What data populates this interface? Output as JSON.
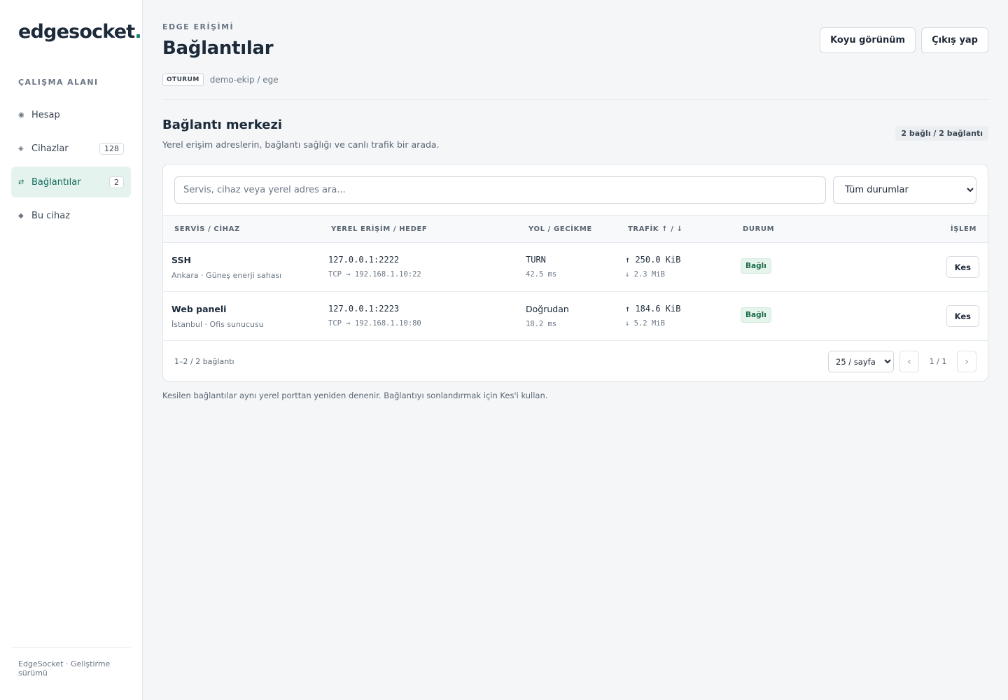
{
  "sidebar": {
    "logo_text": "edgesocket",
    "logo_dot": ".",
    "section_label": "ÇALIŞMA ALANI",
    "items": [
      {
        "icon": "◉",
        "icon_name": "account-icon",
        "label": "Hesap",
        "badge": ""
      },
      {
        "icon": "◈",
        "icon_name": "devices-icon",
        "label": "Cihazlar",
        "badge": "128"
      },
      {
        "icon": "⇄",
        "icon_name": "connections-icon",
        "label": "Bağlantılar",
        "badge": "2"
      },
      {
        "icon": "◆",
        "icon_name": "this-device-icon",
        "label": "Bu cihaz",
        "badge": ""
      }
    ],
    "footer": "EdgeSocket · Geliştirme sürümü"
  },
  "header": {
    "eyebrow": "EDGE ERİŞİMİ",
    "title": "Bağlantılar",
    "session_tag": "OTURUM",
    "session_value": "demo-ekip / ege",
    "dark_mode_label": "Koyu görünüm",
    "logout_label": "Çıkış yap"
  },
  "section": {
    "title": "Bağlantı merkezi",
    "subtitle": "Yerel erişim adreslerin, bağlantı sağlığı ve canlı trafik bir arada.",
    "summary": "2 bağlı / 2 bağlantı"
  },
  "filters": {
    "search_placeholder": "Servis, cihaz veya yerel adres ara...",
    "status_selected": "Tüm durumlar"
  },
  "table": {
    "columns": [
      "SERVİS / CİHAZ",
      "YEREL ERİŞİM / HEDEF",
      "YOL / GECİKME",
      "TRAFİK ↑ / ↓",
      "DURUM",
      "İŞLEM"
    ],
    "rows": [
      {
        "service": "SSH",
        "device": "Ankara · Güneş enerji sahası",
        "local": "127.0.0.1:2222",
        "target": "TCP → 192.168.1.10:22",
        "path": "TURN",
        "latency": "42.5 ms",
        "up": "↑ 250.0 KiB",
        "down": "↓ 2.3 MiB",
        "status": "Bağlı",
        "action": "Kes"
      },
      {
        "service": "Web paneli",
        "device": "İstanbul · Ofis sunucusu",
        "local": "127.0.0.1:2223",
        "target": "TCP → 192.168.1.10:80",
        "path": "Doğrudan",
        "latency": "18.2 ms",
        "up": "↑ 184.6 KiB",
        "down": "↓ 5.2 MiB",
        "status": "Bağlı",
        "action": "Kes"
      }
    ]
  },
  "pagination": {
    "range": "1–2 / 2 bağlantı",
    "per_page": "25 / sayfa",
    "prev": "‹",
    "page": "1 / 1",
    "next": "›"
  },
  "footnote": "Kesilen bağlantılar aynı yerel porttan yeniden denenir. Bağlantıyı sonlandırmak için Kes'i kullan.",
  "colors": {
    "accent": "#14806a",
    "active_nav_bg": "#e5f3ef",
    "status_ok": "#1a6b4a"
  }
}
